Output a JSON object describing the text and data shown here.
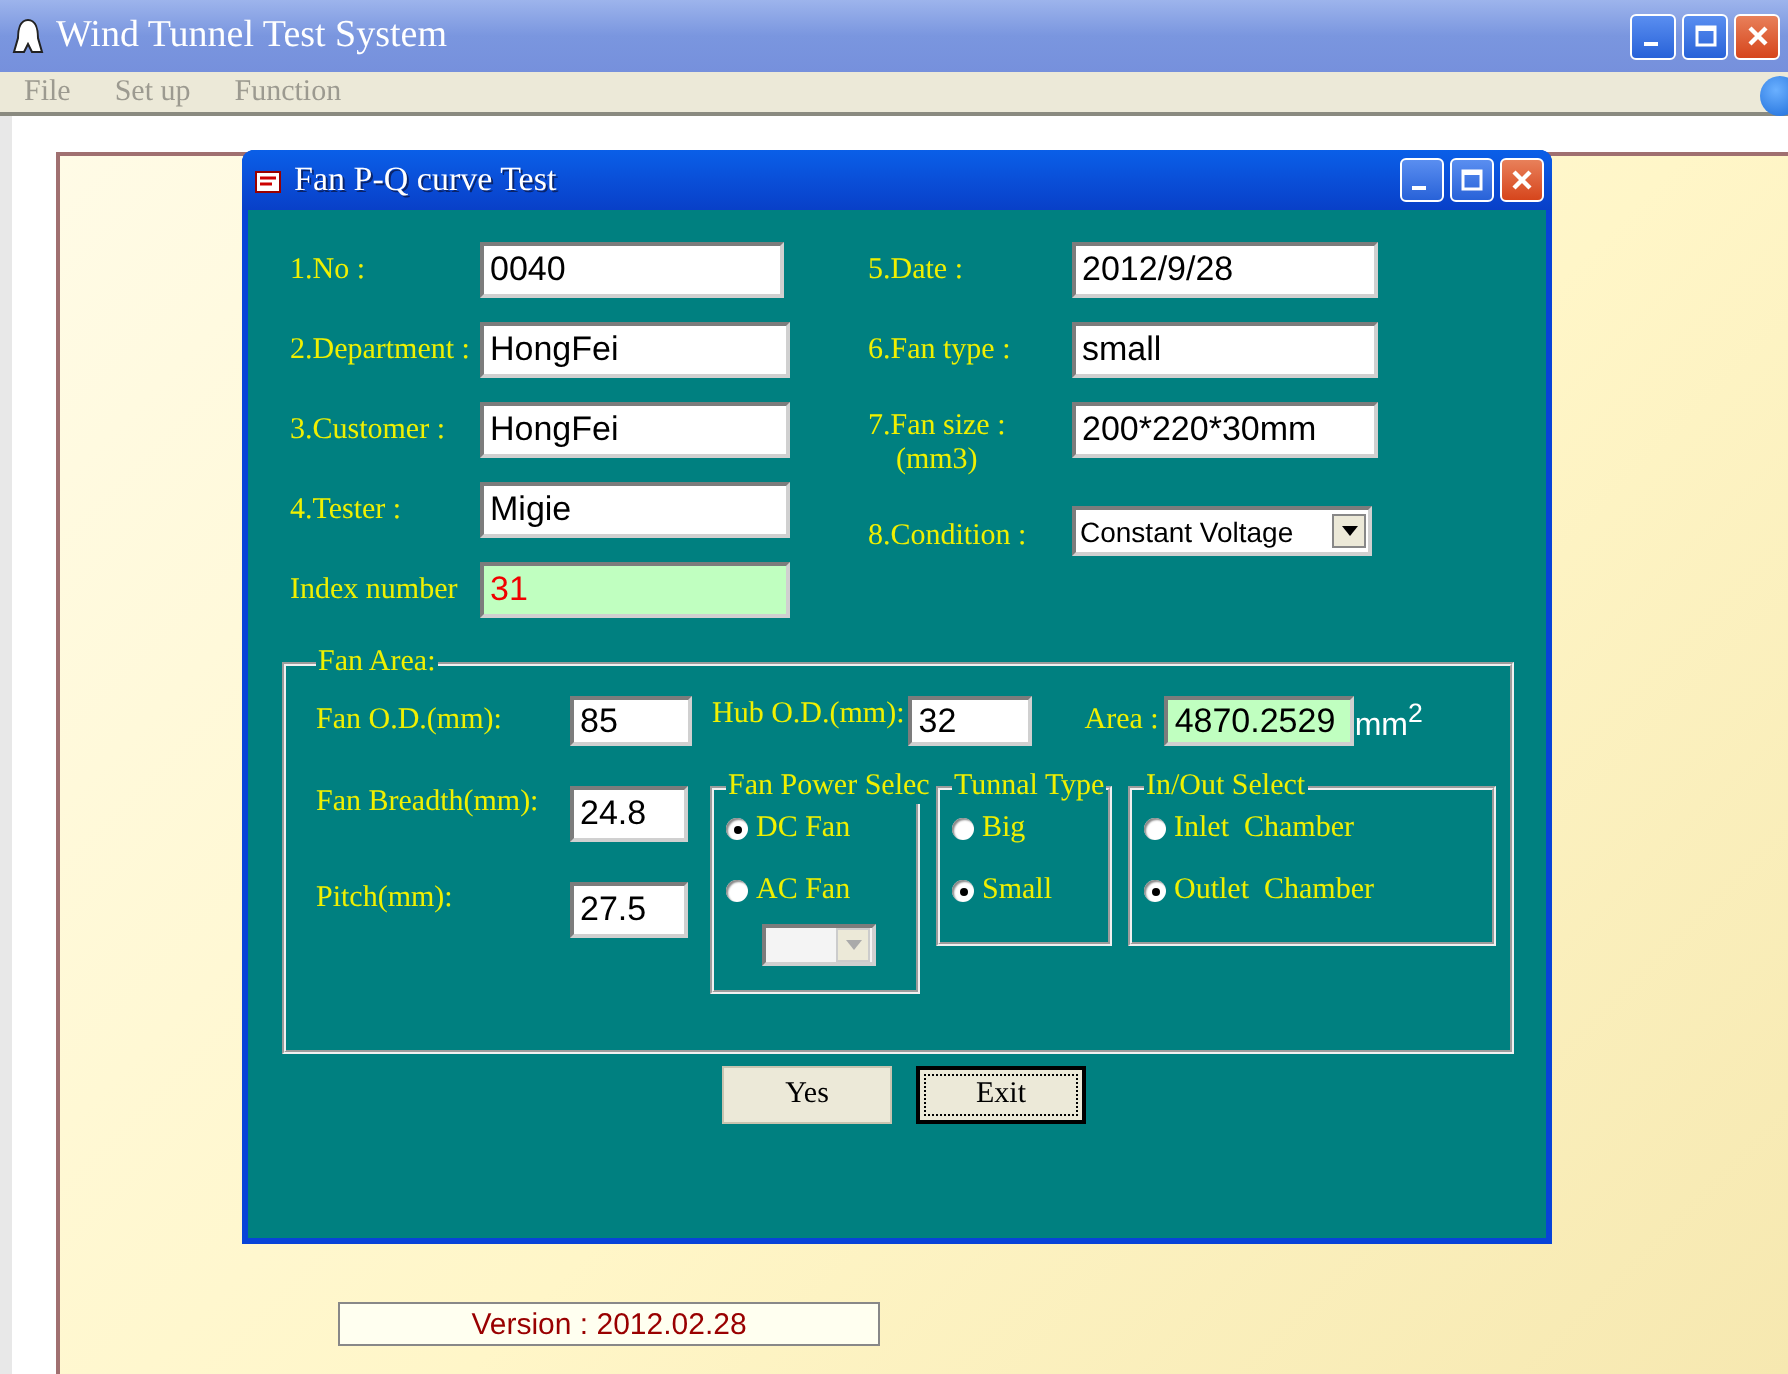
{
  "app": {
    "title": "Wind Tunnel Test System",
    "menu": [
      {
        "label": "File"
      },
      {
        "label": "Set up"
      },
      {
        "label": "Function"
      }
    ]
  },
  "dialog": {
    "title": "Fan P-Q curve Test",
    "fields_left": [
      {
        "label": "1.No :",
        "value": "0040",
        "kind": "text"
      },
      {
        "label": "2.Department :",
        "value": "HongFei",
        "kind": "text"
      },
      {
        "label": "3.Customer :",
        "value": "HongFei",
        "kind": "text"
      },
      {
        "label": "4.Tester :",
        "value": "Migie",
        "kind": "text"
      },
      {
        "label": "Index number",
        "value": "31",
        "kind": "readonly"
      }
    ],
    "fields_right": [
      {
        "label": "5.Date :",
        "value": "2012/9/28",
        "kind": "text"
      },
      {
        "label": "6.Fan type :",
        "value": "small",
        "kind": "text"
      },
      {
        "label": "7.Fan size :",
        "sublabel": "(mm3)",
        "value": "200*220*30mm",
        "kind": "text"
      },
      {
        "label": "8.Condition :",
        "value": "Constant Voltage",
        "kind": "dropdown"
      }
    ],
    "fan_area": {
      "title": "Fan Area:",
      "fan_od": {
        "label": "Fan O.D.(mm):",
        "value": "85"
      },
      "hub_od": {
        "label": "Hub O.D.(mm):",
        "value": "32"
      },
      "area": {
        "label": "Area :",
        "value": "4870.2529",
        "unit": "mm$^{2}$"
      },
      "breadth": {
        "label": "Fan Breadth(mm):",
        "value": "24.8"
      },
      "pitch": {
        "label": "Pitch(mm):",
        "value": "27.5"
      },
      "groups": [
        {
          "title": "Fan Power Selec",
          "options": [
            {
              "label": "DC Fan",
              "selected": true
            },
            {
              "label": "AC Fan",
              "selected": false
            }
          ],
          "dropdown": {
            "disabled": true
          }
        },
        {
          "title": "Tunnal Type",
          "options": [
            {
              "label": "Big",
              "selected": false
            },
            {
              "label": "Small",
              "selected": true
            }
          ]
        },
        {
          "title": "In/Out Select",
          "options": [
            {
              "label": "Inlet  Chamber",
              "selected": false
            },
            {
              "label": "Outlet  Chamber",
              "selected": true
            }
          ]
        }
      ]
    },
    "buttons": [
      {
        "label": "Yes",
        "focused": false
      },
      {
        "label": "Exit",
        "focused": true
      }
    ]
  },
  "version": "Version : 2012.02.28"
}
